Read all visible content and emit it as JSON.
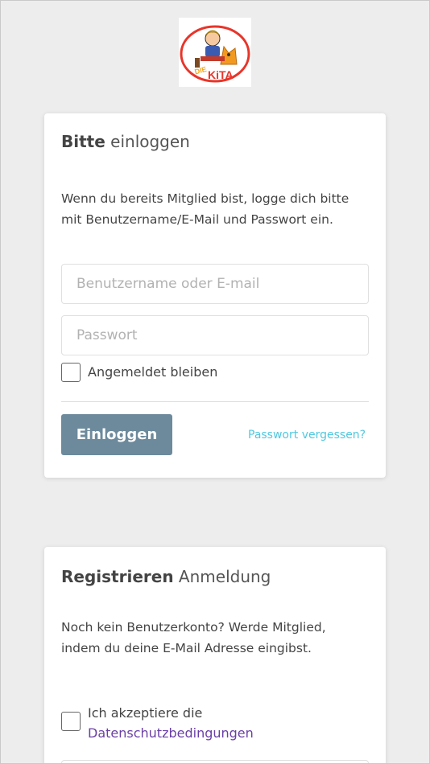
{
  "logo": {
    "text": "DIE KITA",
    "alt": "Die Kita logo"
  },
  "login": {
    "title_bold": "Bitte",
    "title_light": "einloggen",
    "description": "Wenn du bereits Mitglied bist, logge dich bitte mit Benutzername/E-Mail und Passwort ein.",
    "username_placeholder": "Benutzername oder E-mail",
    "username_value": "",
    "password_placeholder": "Passwort",
    "password_value": "",
    "remember_label": "Angemeldet bleiben",
    "remember_checked": false,
    "login_button": "Einloggen",
    "forgot_link": "Passwort vergessen?"
  },
  "register": {
    "title_bold": "Registrieren",
    "title_light": "Anmeldung",
    "description": "Noch kein Benutzerkonto? Werde Mitglied, indem du deine E-Mail Adresse eingibst.",
    "privacy_prefix": "Ich akzeptiere die",
    "privacy_link": "Datenschutzbedingungen",
    "privacy_checked": false
  },
  "colors": {
    "login_button": "#6d8a9c",
    "forgot_link": "#4fc8e0",
    "privacy_link": "#6a3fa6",
    "background": "#ededed"
  }
}
